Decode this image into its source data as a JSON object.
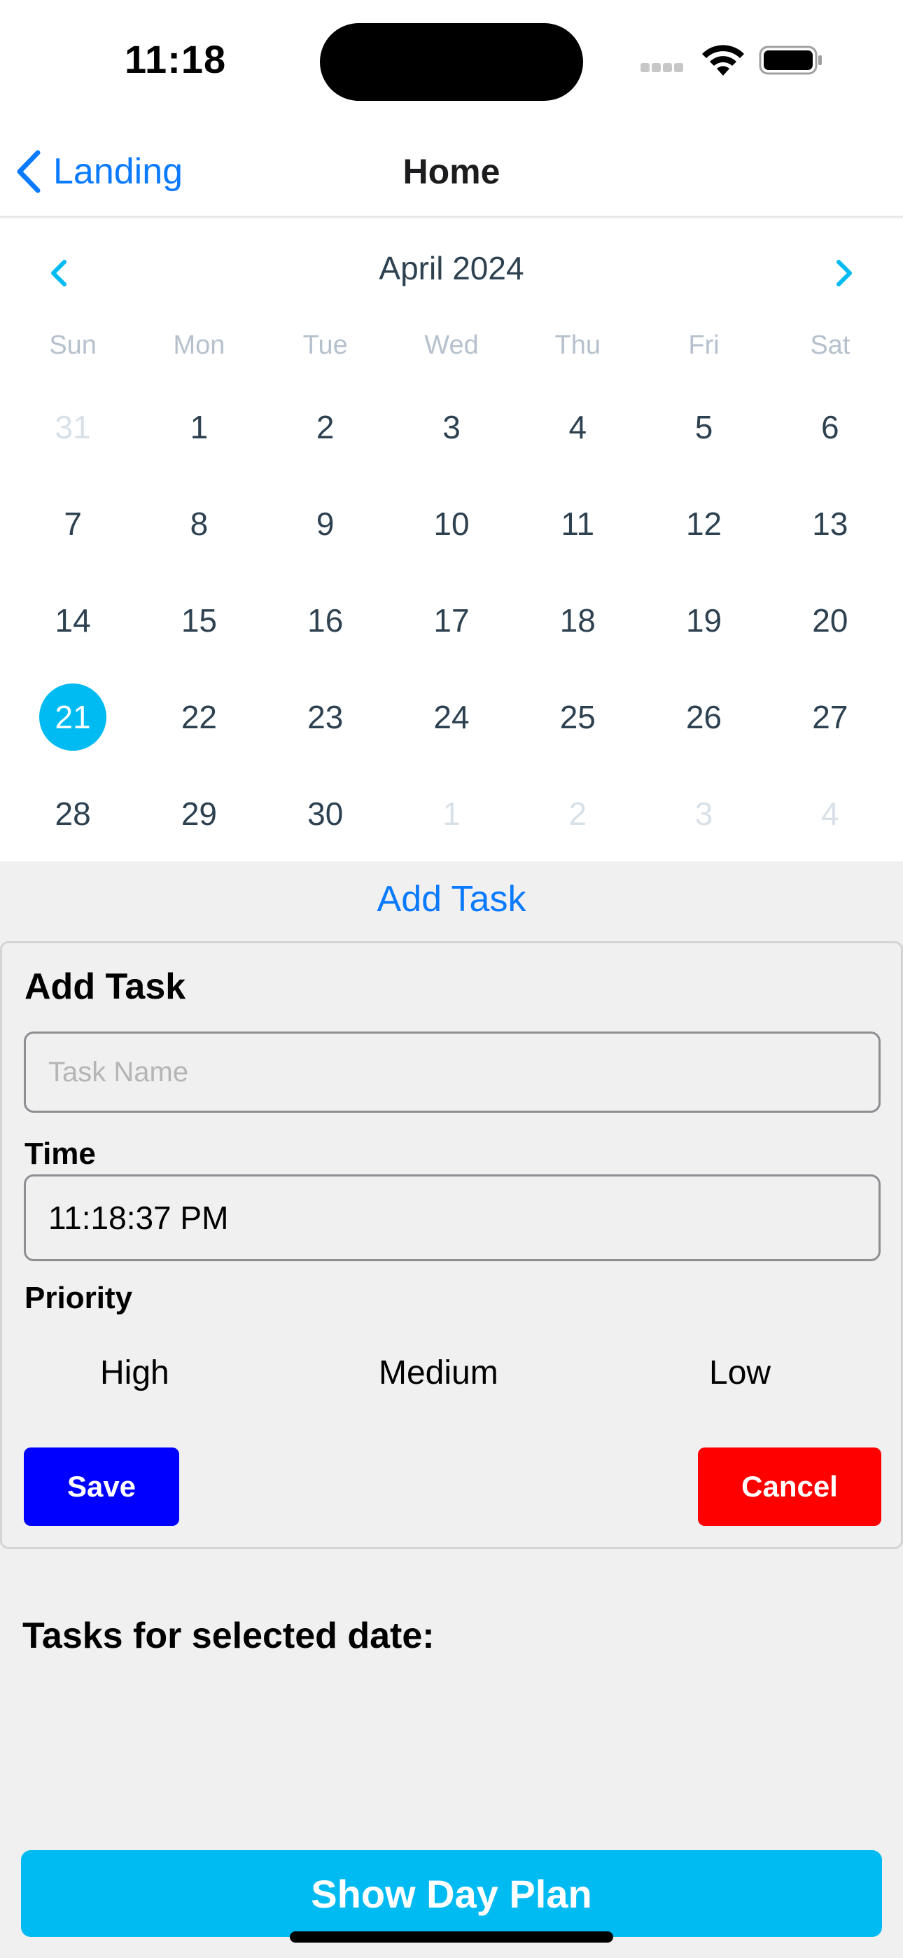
{
  "status_bar": {
    "time": "11:18",
    "icons": [
      "cellular-signal-icon",
      "wifi-icon",
      "battery-icon"
    ]
  },
  "nav": {
    "back_label": "Landing",
    "title": "Home"
  },
  "calendar": {
    "month_label": "April 2024",
    "weekdays": [
      "Sun",
      "Mon",
      "Tue",
      "Wed",
      "Thu",
      "Fri",
      "Sat"
    ],
    "selected_day": "21",
    "accent_color": "#00bbf2",
    "weeks": [
      [
        {
          "d": "31",
          "muted": true
        },
        {
          "d": "1"
        },
        {
          "d": "2"
        },
        {
          "d": "3"
        },
        {
          "d": "4"
        },
        {
          "d": "5"
        },
        {
          "d": "6"
        }
      ],
      [
        {
          "d": "7"
        },
        {
          "d": "8"
        },
        {
          "d": "9"
        },
        {
          "d": "10"
        },
        {
          "d": "11"
        },
        {
          "d": "12"
        },
        {
          "d": "13"
        }
      ],
      [
        {
          "d": "14"
        },
        {
          "d": "15"
        },
        {
          "d": "16"
        },
        {
          "d": "17"
        },
        {
          "d": "18"
        },
        {
          "d": "19"
        },
        {
          "d": "20"
        }
      ],
      [
        {
          "d": "21",
          "selected": true
        },
        {
          "d": "22"
        },
        {
          "d": "23"
        },
        {
          "d": "24"
        },
        {
          "d": "25"
        },
        {
          "d": "26"
        },
        {
          "d": "27"
        }
      ],
      [
        {
          "d": "28"
        },
        {
          "d": "29"
        },
        {
          "d": "30"
        },
        {
          "d": "1",
          "muted": true
        },
        {
          "d": "2",
          "muted": true
        },
        {
          "d": "3",
          "muted": true
        },
        {
          "d": "4",
          "muted": true
        }
      ]
    ]
  },
  "add_task_link": "Add Task",
  "form": {
    "title": "Add Task",
    "task_name_value": "",
    "task_name_placeholder": "Task Name",
    "time_label": "Time",
    "time_value": "11:18:37 PM",
    "priority_label": "Priority",
    "priority_options": [
      "High",
      "Medium",
      "Low"
    ],
    "save_label": "Save",
    "cancel_label": "Cancel",
    "save_color": "#0000ff",
    "cancel_color": "#ff0000"
  },
  "tasks": {
    "heading": "Tasks for selected date:",
    "items": []
  },
  "day_plan_button": "Show Day Plan"
}
